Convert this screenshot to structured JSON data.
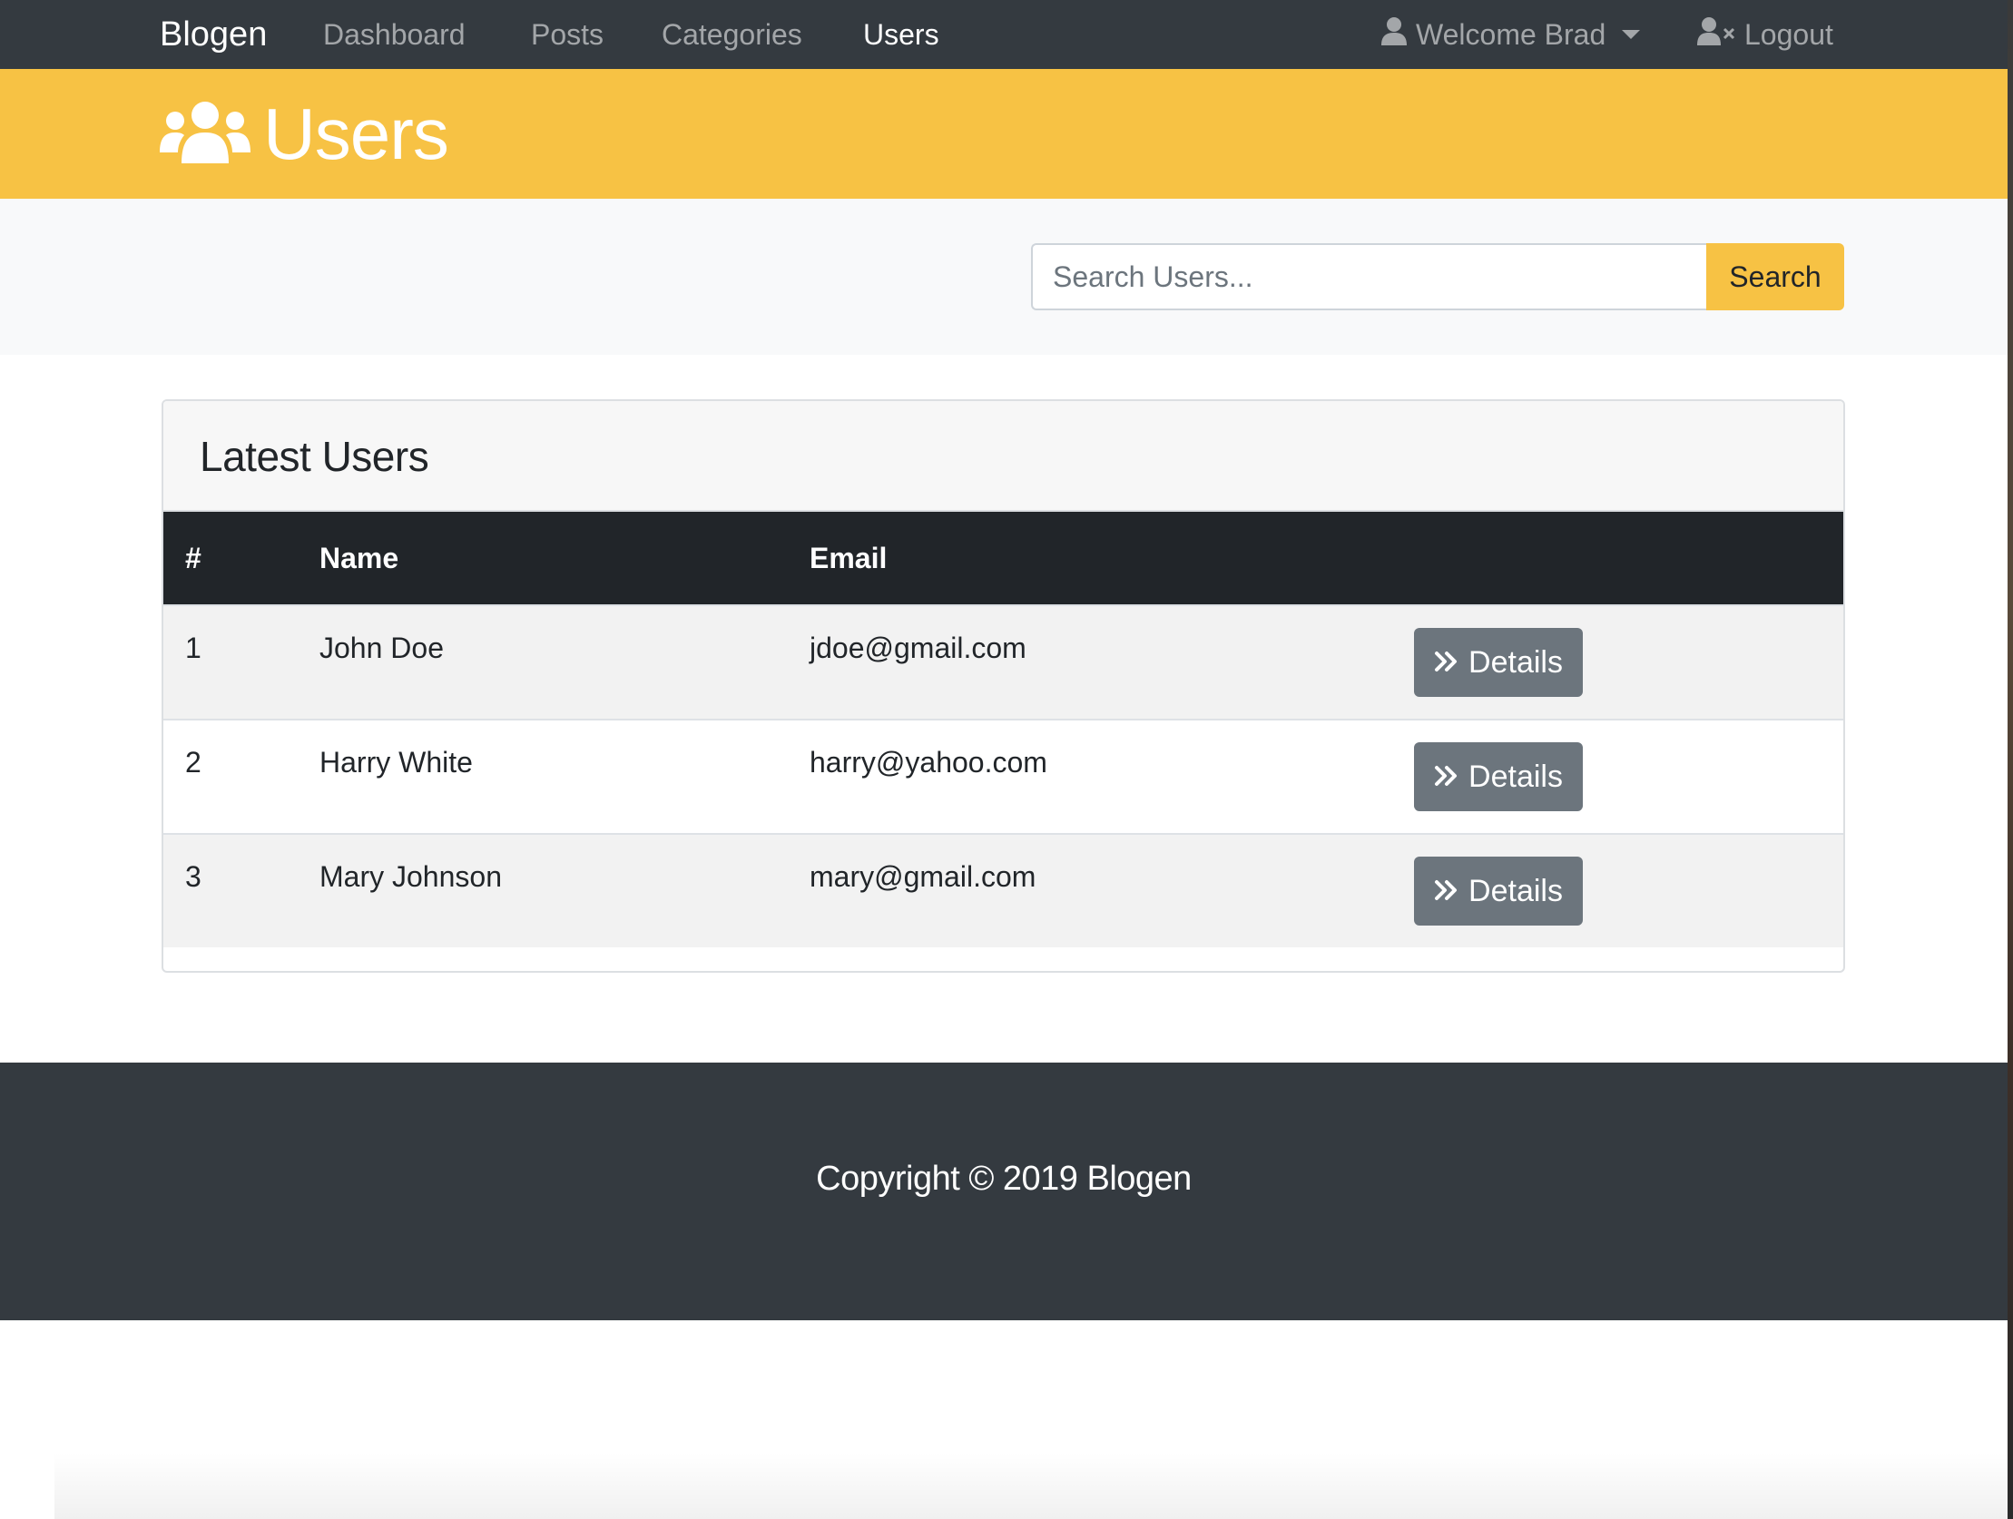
{
  "navbar": {
    "brand": "Blogen",
    "links": [
      {
        "label": "Dashboard",
        "active": false
      },
      {
        "label": "Posts",
        "active": false
      },
      {
        "label": "Categories",
        "active": false
      },
      {
        "label": "Users",
        "active": true
      }
    ],
    "user_menu": "Welcome Brad",
    "logout": "Logout"
  },
  "header": {
    "title": "Users",
    "icon": "users-icon",
    "color": "#f7c244"
  },
  "search": {
    "placeholder": "Search Users...",
    "value": "",
    "button": "Search"
  },
  "card": {
    "title": "Latest Users",
    "columns": [
      "#",
      "Name",
      "Email",
      ""
    ],
    "rows": [
      {
        "id": "1",
        "name": "John Doe",
        "email": "jdoe@gmail.com",
        "action": "Details"
      },
      {
        "id": "2",
        "name": "Harry White",
        "email": "harry@yahoo.com",
        "action": "Details"
      },
      {
        "id": "3",
        "name": "Mary Johnson",
        "email": "mary@gmail.com",
        "action": "Details"
      }
    ]
  },
  "footer": {
    "copyright": "Copyright © 2019 Blogen"
  },
  "colors": {
    "navbar": "#343a40",
    "accent": "#f7c244",
    "table_head": "#212529",
    "secondary_button": "#6c757d"
  }
}
